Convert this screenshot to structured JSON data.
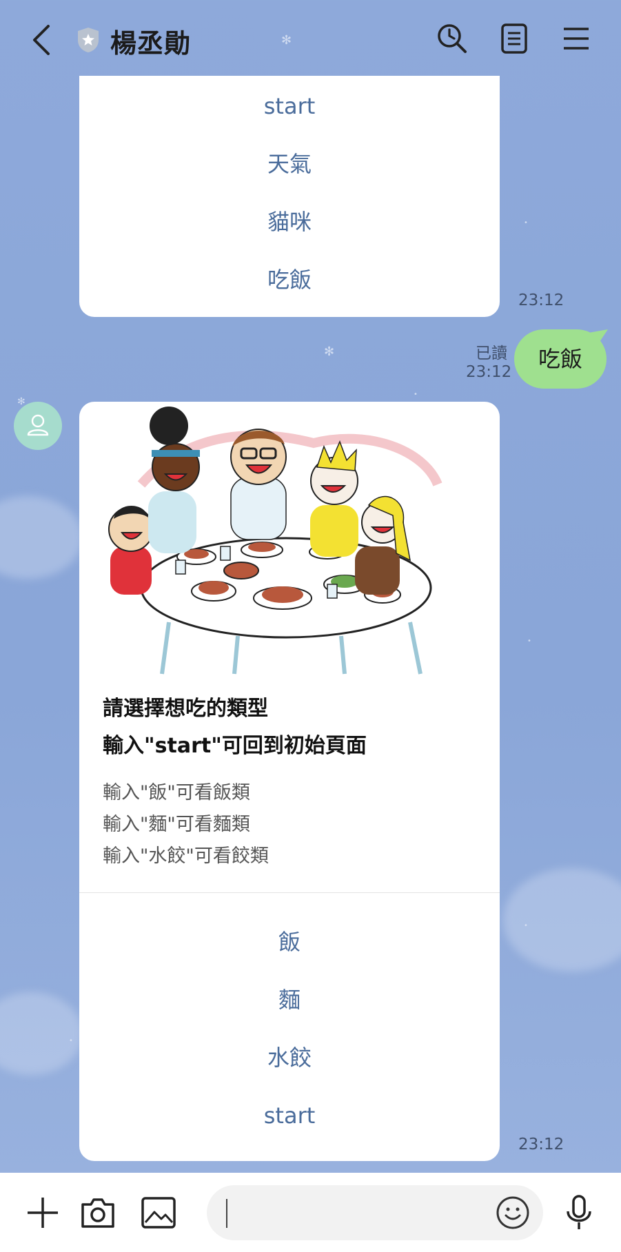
{
  "header": {
    "chat_title": "楊丞勛"
  },
  "messages": {
    "menu1": {
      "options": [
        "start",
        "天氣",
        "貓咪",
        "吃飯"
      ],
      "time": "23:12"
    },
    "sent": {
      "text": "吃飯",
      "read_label": "已讀",
      "time": "23:12"
    },
    "food_card": {
      "title_line1": "請選擇想吃的類型",
      "title_line2": "輸入\"start\"可回到初始頁面",
      "lines": [
        "輸入\"飯\"可看飯類",
        "輸入\"麵\"可看麵類",
        "輸入\"水餃\"可看餃類"
      ],
      "options": [
        "飯",
        "麵",
        "水餃",
        "start"
      ],
      "time": "23:12"
    }
  },
  "colors": {
    "background": "#8ea9da",
    "sent_bubble": "#9fe08f",
    "option_text": "#4a6c9b"
  }
}
